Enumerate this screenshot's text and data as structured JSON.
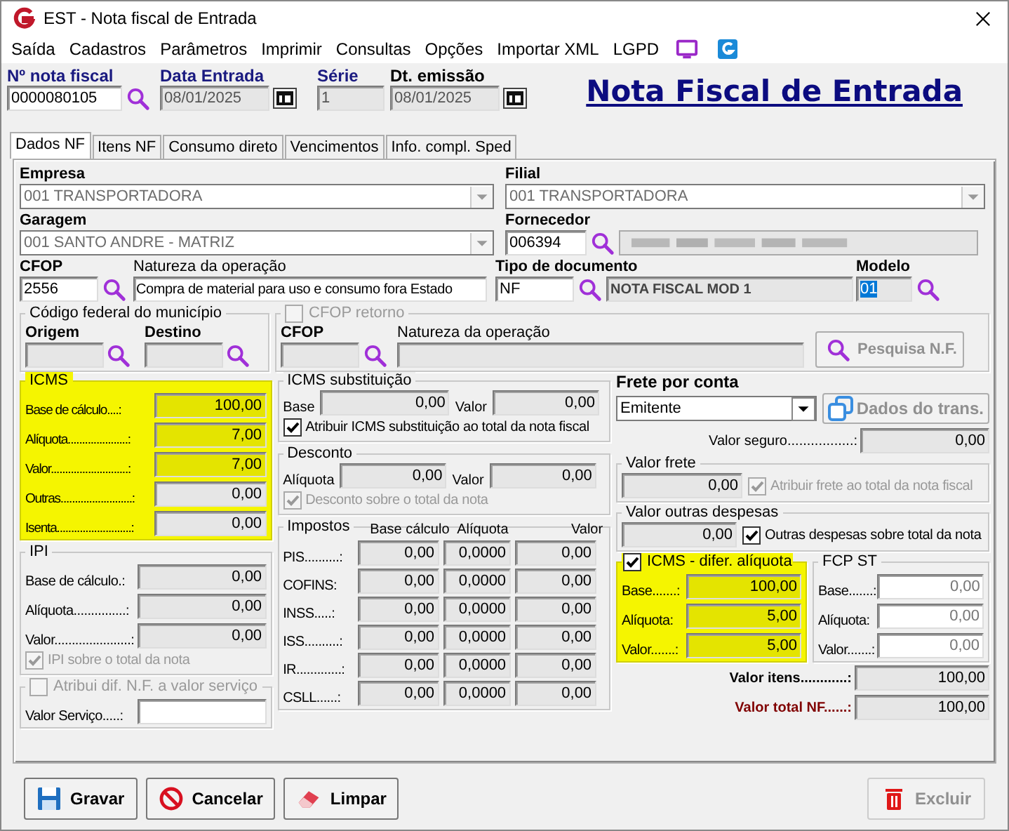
{
  "window": {
    "title": "EST - Nota fiscal de Entrada"
  },
  "menu": [
    "Saída",
    "Cadastros",
    "Parâmetros",
    "Imprimir",
    "Consultas",
    "Opções",
    "Importar XML",
    "LGPD"
  ],
  "header_fields": [
    {
      "label": "Nº nota fiscal",
      "value": "0000080105",
      "kind": "search"
    },
    {
      "label": "Data Entrada",
      "value": "08/01/2025",
      "kind": "date"
    },
    {
      "label": "Série",
      "value": "1",
      "kind": "plain"
    },
    {
      "label": "Dt. emissão",
      "value": "08/01/2025",
      "kind": "date"
    }
  ],
  "page_title": "Nota Fiscal de Entrada",
  "tabs": [
    {
      "label": "Dados NF",
      "selected": true
    },
    {
      "label": "Itens NF",
      "selected": false
    },
    {
      "label": "Consumo direto",
      "selected": false
    },
    {
      "label": "Vencimentos",
      "selected": false
    },
    {
      "label": "Info. compl. Sped",
      "selected": false
    }
  ],
  "empresa": {
    "label": "Empresa",
    "value": "001 TRANSPORTADORA"
  },
  "filial": {
    "label": "Filial",
    "value": "001 TRANSPORTADORA"
  },
  "garagem": {
    "label": "Garagem",
    "value": "001 SANTO ANDRE - MATRIZ"
  },
  "fornecedor": {
    "label": "Fornecedor",
    "code": "006394"
  },
  "cfop": {
    "label": "CFOP",
    "value": "2556",
    "nature_label": "Natureza da operação",
    "nature": "Compra de material para uso e consumo fora Estado"
  },
  "tipo_documento": {
    "label": "Tipo de documento",
    "code": "NF",
    "description": "NOTA FISCAL MOD 1"
  },
  "modelo": {
    "label": "Modelo",
    "value": "01",
    "selected": true
  },
  "codigo_federal": {
    "title": "Código federal do município",
    "origem_label": "Origem",
    "destino_label": "Destino"
  },
  "cfop_retorno": {
    "title": "CFOP retorno",
    "checked": false,
    "disabled": true,
    "cfop_label": "CFOP",
    "nature_label": "Natureza da operação",
    "button": {
      "label": "Pesquisa N.F.",
      "disabled": true
    }
  },
  "icms": {
    "title": "ICMS",
    "highlighted": true,
    "rows": [
      {
        "label": "Base de cálculo....:",
        "value": "100,00",
        "highlighted": true
      },
      {
        "label": "Alíquota.....................:",
        "value": "7,00",
        "highlighted": true
      },
      {
        "label": "Valor...........................:",
        "value": "7,00",
        "highlighted": true
      },
      {
        "label": "Outras.........................:",
        "value": "0,00",
        "highlighted": false
      },
      {
        "label": "Isenta..........................:",
        "value": "0,00",
        "highlighted": false
      }
    ]
  },
  "icms_st": {
    "title": "ICMS substituição",
    "base_label": "Base",
    "base": "0,00",
    "valor_label": "Valor",
    "valor": "0,00",
    "check": {
      "label": "Atribuir ICMS substituição ao total da nota fiscal",
      "checked": true,
      "disabled": false
    }
  },
  "desconto": {
    "title": "Desconto",
    "aliquota_label": "Alíquota",
    "aliquota": "0,00",
    "valor_label": "Valor",
    "valor": "0,00",
    "check": {
      "label": "Desconto sobre o total da nota",
      "checked": true,
      "disabled": true
    }
  },
  "frete_por_conta": {
    "label": "Frete por conta",
    "value": "Emitente",
    "button": {
      "label": "Dados do trans.",
      "disabled": true
    },
    "seguro_label": "Valor seguro.................:",
    "seguro": "0,00"
  },
  "valor_frete": {
    "title": "Valor frete",
    "value": "0,00",
    "check": {
      "label": "Atribuir frete ao total da nota fiscal",
      "checked": true,
      "disabled": true
    }
  },
  "outras_despesas": {
    "title": "Valor outras despesas",
    "value": "0,00",
    "check": {
      "label": "Outras despesas sobre total da nota",
      "checked": true,
      "disabled": false
    }
  },
  "ipi": {
    "title": "IPI",
    "rows": [
      {
        "label": "Base de cálculo.:",
        "value": "0,00"
      },
      {
        "label": "Alíquota...............:",
        "value": "0,00"
      },
      {
        "label": "Valor......................:",
        "value": "0,00"
      }
    ],
    "check": {
      "label": "IPI sobre o total da nota",
      "checked": true,
      "disabled": true
    }
  },
  "atribui_servico": {
    "title": "Atribui dif. N.F. a valor serviço",
    "checked": false,
    "disabled": true,
    "field_label": "Valor Serviço.....:"
  },
  "impostos": {
    "title": "Impostos",
    "columns": [
      "Base cálculo",
      "Alíquota",
      "Valor"
    ],
    "rows": [
      {
        "label": "PIS..........:",
        "base": "0,00",
        "aliquota": "0,0000",
        "valor": "0,00"
      },
      {
        "label": "COFINS:",
        "base": "0,00",
        "aliquota": "0,0000",
        "valor": "0,00"
      },
      {
        "label": "INSS.....:",
        "base": "0,00",
        "aliquota": "0,0000",
        "valor": "0,00"
      },
      {
        "label": "ISS..........:",
        "base": "0,00",
        "aliquota": "0,0000",
        "valor": "0,00"
      },
      {
        "label": "IR.............:",
        "base": "0,00",
        "aliquota": "0,0000",
        "valor": "0,00"
      },
      {
        "label": "CSLL......:",
        "base": "0,00",
        "aliquota": "0,0000",
        "valor": "0,00"
      }
    ]
  },
  "icms_difal": {
    "title": "ICMS - difer. alíquota",
    "checked": true,
    "highlighted": true,
    "rows": [
      {
        "label": "Base.......:",
        "value": "100,00"
      },
      {
        "label": "Alíquota:",
        "value": "5,00"
      },
      {
        "label": "Valor.......:",
        "value": "5,00"
      }
    ]
  },
  "fcp_st": {
    "title": "FCP ST",
    "rows": [
      {
        "label": "Base.......:",
        "value": "0,00"
      },
      {
        "label": "Alíquota:",
        "value": "0,00"
      },
      {
        "label": "Valor.......:",
        "value": "0,00"
      }
    ]
  },
  "totals": [
    {
      "label": "Valor itens............:",
      "value": "100,00",
      "color": "#000000"
    },
    {
      "label": "Valor total NF......:",
      "value": "100,00",
      "color": "#800000"
    }
  ],
  "buttons": [
    {
      "label": "Gravar",
      "kind": "save",
      "disabled": false
    },
    {
      "label": "Cancelar",
      "kind": "cancel",
      "disabled": false
    },
    {
      "label": "Limpar",
      "kind": "clear",
      "disabled": false
    },
    {
      "label": "Excluir",
      "kind": "delete",
      "disabled": true
    }
  ]
}
